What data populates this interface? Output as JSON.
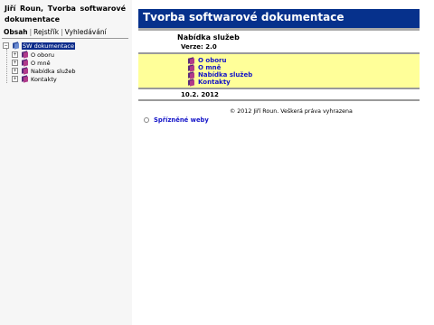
{
  "sidebar": {
    "title": "Jiří Roun, Tvorba softwarové dokumentace",
    "tabs": [
      "Obsah",
      "Rejstřík",
      "Vyhledávání"
    ],
    "tree": [
      {
        "label": "SW dokumentace",
        "expander": "−",
        "selected": true
      },
      {
        "label": "O oboru",
        "expander": "+"
      },
      {
        "label": "O mně",
        "expander": "+"
      },
      {
        "label": "Nabídka služeb",
        "expander": "+"
      },
      {
        "label": "Kontakty",
        "expander": "+"
      }
    ]
  },
  "content": {
    "header_title": "Tvorba softwarové dokumentace",
    "page_heading": "Nabídka služeb",
    "version": "Verze: 2.0",
    "menu": [
      "O oboru",
      "O mně",
      "Nabídka služeb",
      "Kontakty"
    ],
    "date": "10.2. 2012",
    "copyright": "© 2012 Jiří Roun. Veškerá práva vyhrazena",
    "related_link": "Spřízněné weby"
  },
  "colors": {
    "header_bg": "#06318c",
    "menu_bg": "#ffff99",
    "link": "#1414c8",
    "selection": "#0a2a8a"
  }
}
